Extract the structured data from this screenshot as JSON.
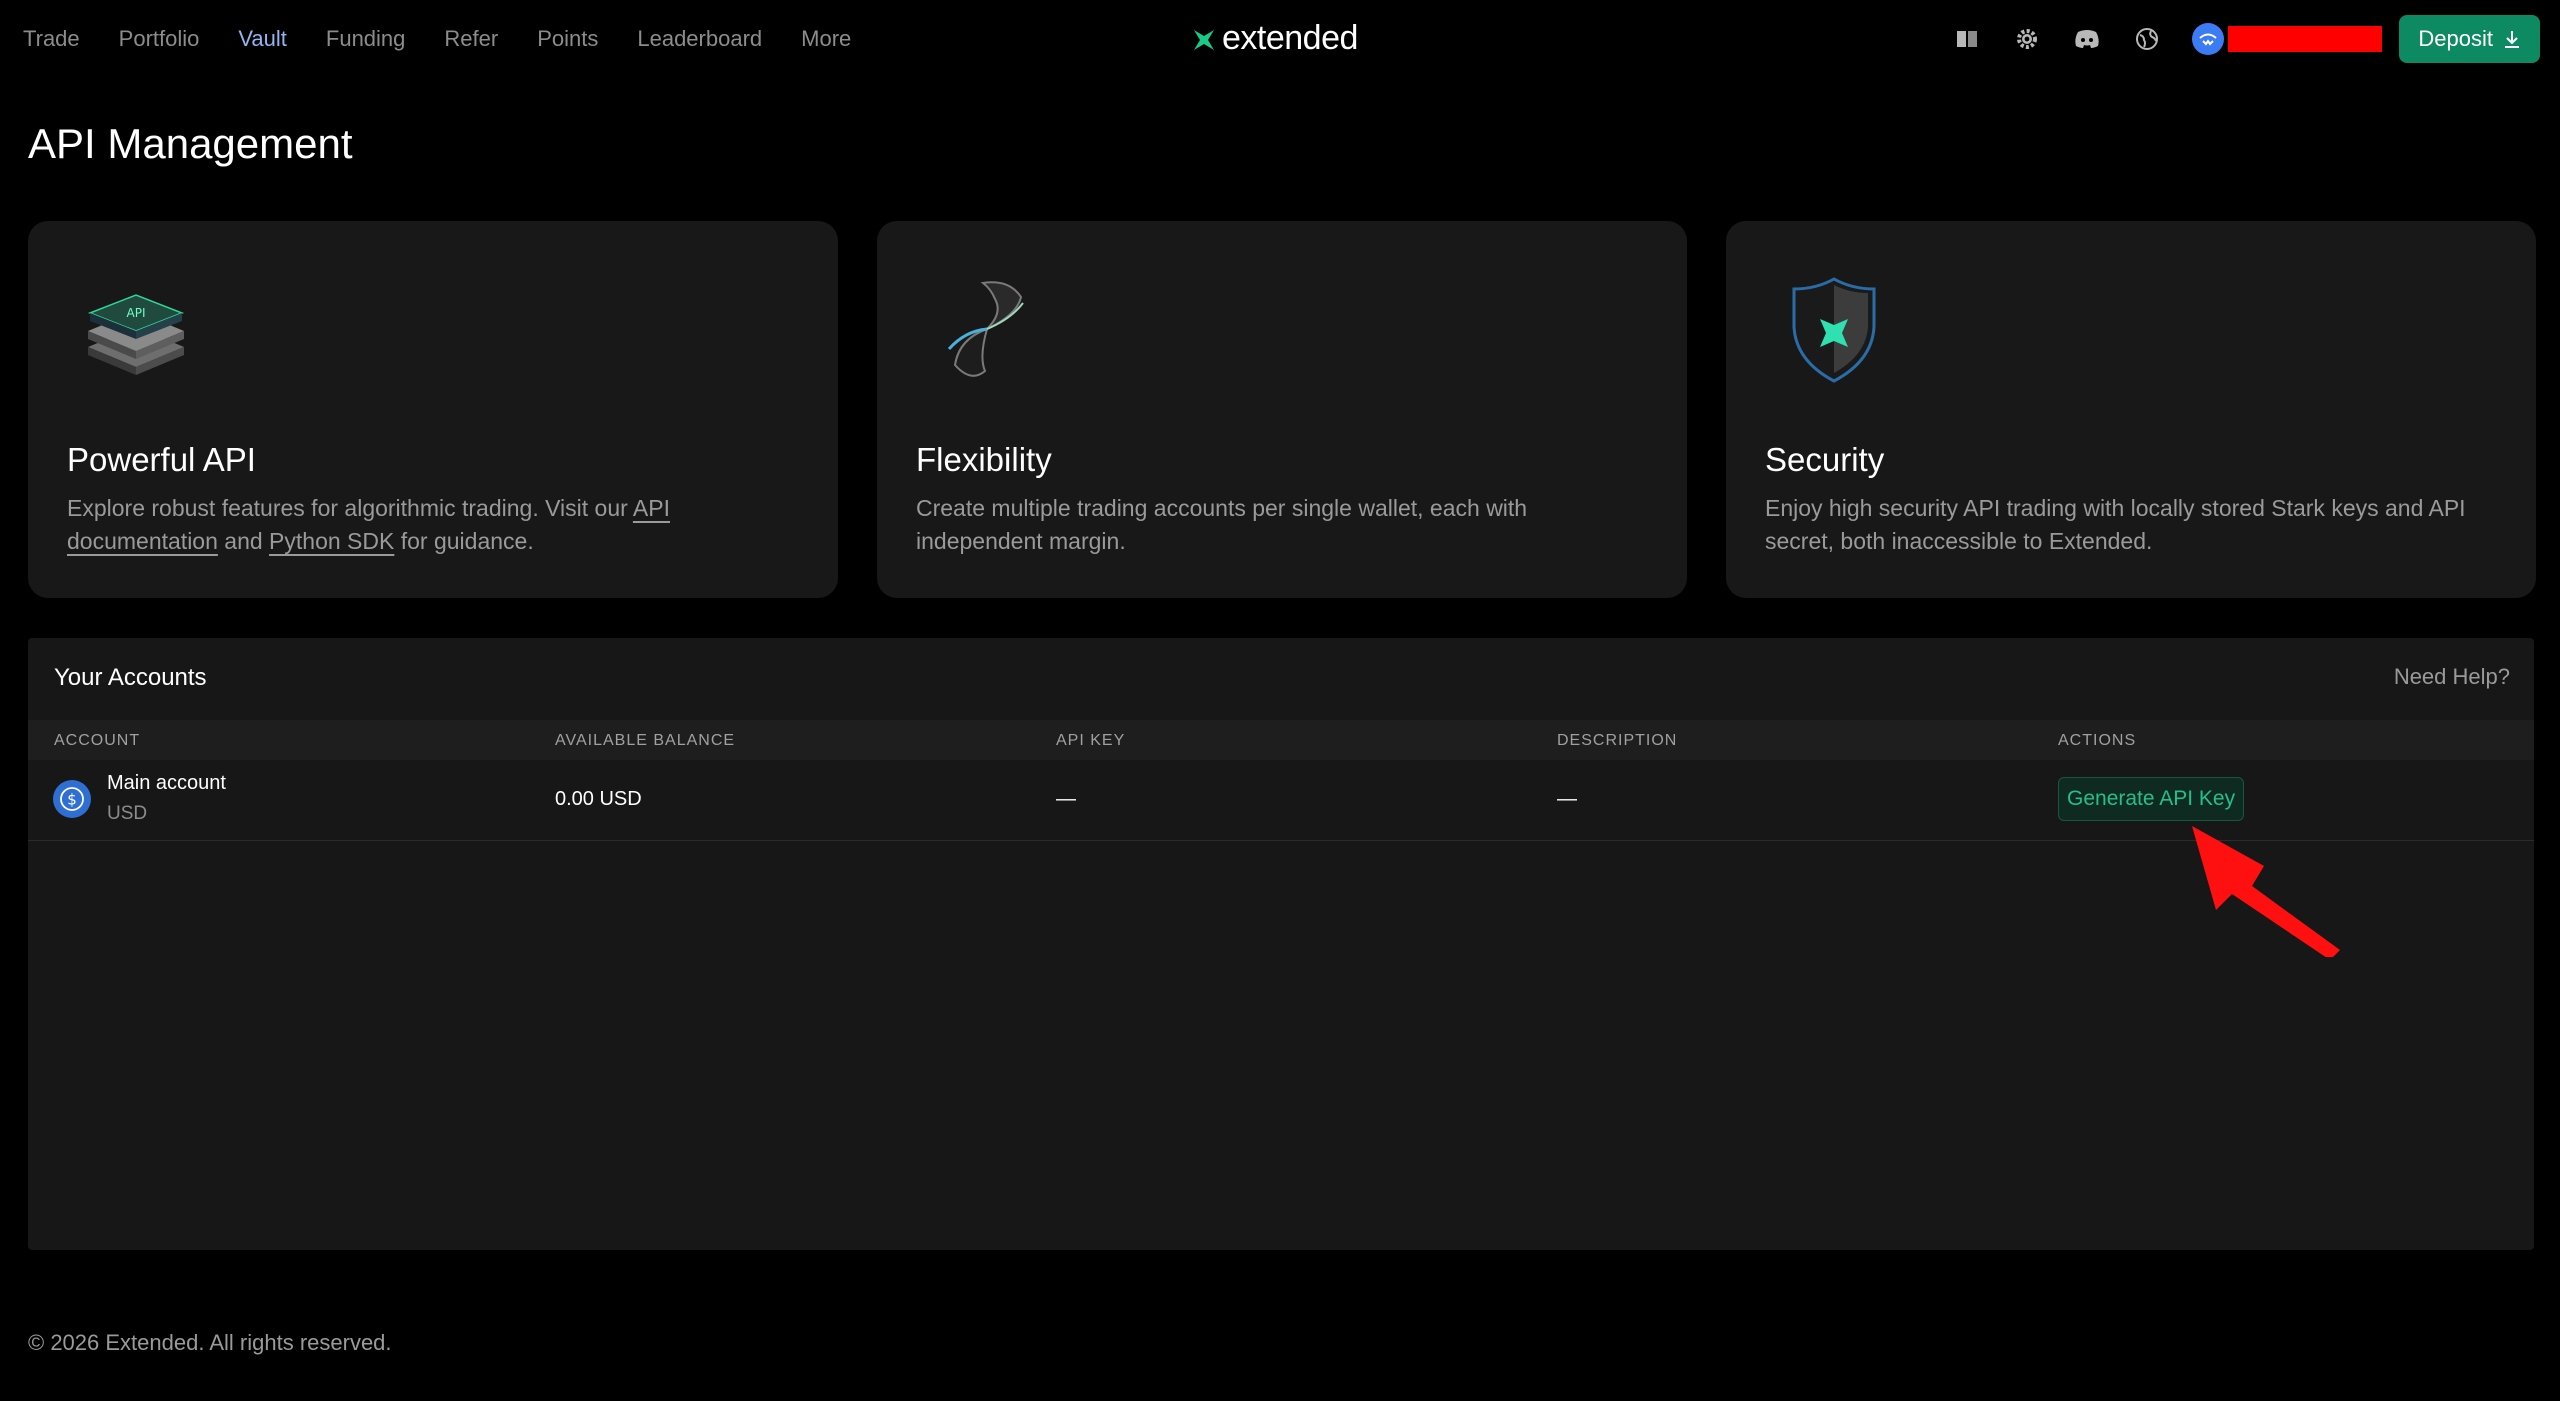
{
  "nav": {
    "items": [
      "Trade",
      "Portfolio",
      "Vault",
      "Funding",
      "Refer",
      "Points",
      "Leaderboard",
      "More"
    ],
    "active": "Vault"
  },
  "brand": {
    "name": "extended",
    "accent": "#0e8a63"
  },
  "header": {
    "deposit_label": "Deposit"
  },
  "page": {
    "title": "API Management"
  },
  "features": [
    {
      "icon": "api-stack-icon",
      "title": "Powerful API",
      "desc_pre": "Explore robust features for algorithmic trading. Visit our ",
      "link1": "API documentation",
      "desc_mid": " and ",
      "link2": "Python SDK",
      "desc_post": " for guidance."
    },
    {
      "icon": "hourglass-icon",
      "title": "Flexibility",
      "desc": "Create multiple trading accounts per single wallet, each with independent margin."
    },
    {
      "icon": "shield-icon",
      "title": "Security",
      "desc": "Enjoy high security API trading with locally stored Stark keys and API secret, both inaccessible to Extended."
    }
  ],
  "accounts": {
    "title": "Your Accounts",
    "help": "Need Help?",
    "columns": [
      "ACCOUNT",
      "AVAILABLE BALANCE",
      "API KEY",
      "DESCRIPTION",
      "ACTIONS"
    ],
    "rows": [
      {
        "name": "Main account",
        "currency": "USD",
        "balance": "0.00 USD",
        "api_key": "—",
        "description": "—",
        "action": "Generate API Key"
      }
    ]
  },
  "footer": {
    "text": "© 2026 Extended. All rights reserved."
  }
}
